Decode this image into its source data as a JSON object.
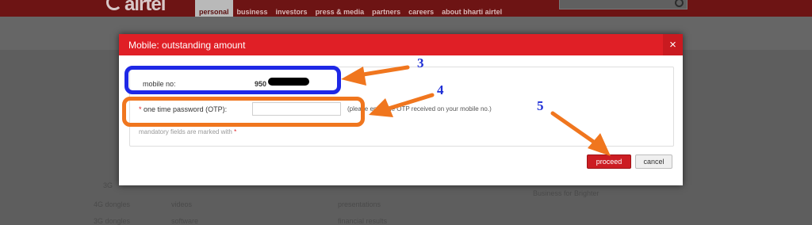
{
  "site": {
    "brand": "airtel",
    "nav": [
      "personal",
      "business",
      "investors",
      "press & media",
      "partners",
      "careers",
      "about bharti airtel"
    ],
    "active_nav": "personal"
  },
  "background": {
    "links": [
      "4G dongles",
      "videos",
      "presentations",
      "3G dongles",
      "software",
      "financial results",
      "Business for Brighter",
      "3G"
    ]
  },
  "modal": {
    "title": "Mobile: outstanding amount",
    "close_label": "×",
    "mobile_label": "mobile no:",
    "mobile_value": "950",
    "otp_label": "one time password (OTP):",
    "required_mark": "*",
    "otp_value": "",
    "otp_hint": "(please enter the OTP received on your mobile no.)",
    "mandatory_note": "mandatory fields are marked with",
    "proceed_label": "proceed",
    "cancel_label": "cancel"
  },
  "annotations": {
    "callouts": [
      "3",
      "4",
      "5"
    ],
    "highlight_colors": {
      "mobile": "#1e28e6",
      "otp": "#f0761e"
    },
    "arrow_color": "#f0761e"
  }
}
